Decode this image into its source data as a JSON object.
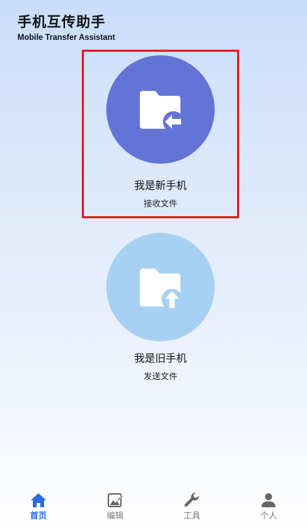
{
  "app": {
    "title": "手机互传助手",
    "subtitle": "Mobile Transfer Assistant"
  },
  "cards": {
    "new_phone": {
      "label": "我是新手机",
      "sub": "接收文件",
      "icon": "folder-receive-icon",
      "circle_color": "#6374d6",
      "selected": true,
      "highlight_color": "#e21d23"
    },
    "old_phone": {
      "label": "我是旧手机",
      "sub": "发送文件",
      "icon": "folder-upload-icon",
      "circle_color": "#a7d1f3"
    }
  },
  "tabbar": {
    "active_color": "#2a6ae0",
    "items": [
      {
        "label": "首页",
        "icon": "home-icon",
        "active": true
      },
      {
        "label": "编辑",
        "icon": "edit-image-icon",
        "active": false
      },
      {
        "label": "工具",
        "icon": "wrench-icon",
        "active": false
      },
      {
        "label": "个人",
        "icon": "person-icon",
        "active": false
      }
    ]
  }
}
